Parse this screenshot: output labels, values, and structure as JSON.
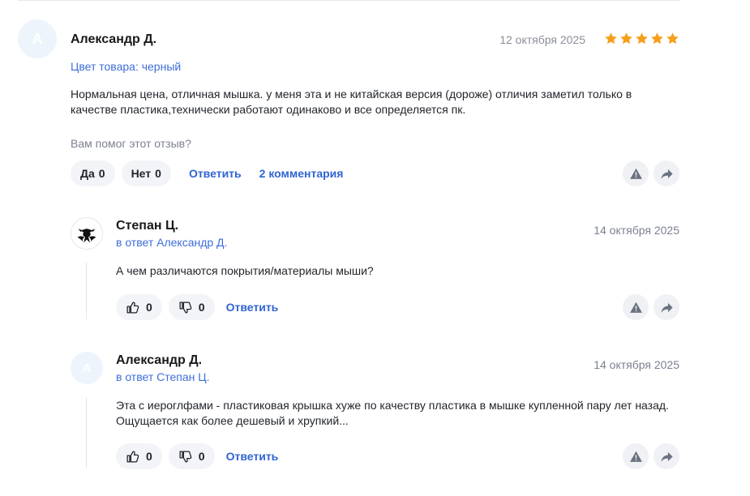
{
  "review": {
    "avatar_letter": "А",
    "author": "Александр Д.",
    "date": "12 октября 2025",
    "rating": 5,
    "color_label": "Цвет товара: черный",
    "text": "Нормальная цена, отличная мышка. у меня эта и не китайская версия (дороже) отличия заметил только в качестве пластика,технически работают одинаково и все определяется пк.",
    "helpful_question": "Вам помог этот отзыв?",
    "yes_label": "Да",
    "yes_count": "0",
    "no_label": "Нет",
    "no_count": "0",
    "reply_label": "Ответить",
    "comments_label": "2 комментария",
    "icons": [
      "warning-icon",
      "share-icon"
    ]
  },
  "comments": [
    {
      "author": "Степан Ц.",
      "reply_to": "в ответ Александр Д.",
      "date": "14 октября 2025",
      "text": "А чем различаются покрытия/материалы мыши?",
      "likes": "0",
      "dislikes": "0",
      "reply_label": "Ответить"
    },
    {
      "avatar_letter": "А",
      "author": "Александр Д.",
      "reply_to": "в ответ Степан Ц.",
      "date": "14 октября 2025",
      "text": "Эта с иероглфами - пластиковая крышка хуже по качеству пластика в мышке купленной пару лет назад. Ощущается как более дешевый и хрупкий...",
      "likes": "0",
      "dislikes": "0",
      "reply_label": "Ответить"
    }
  ],
  "colors": {
    "star": "#f59f1b",
    "link": "#2f64d2",
    "avatar_bg": "#eef4fc",
    "icon": "#6b7280"
  }
}
